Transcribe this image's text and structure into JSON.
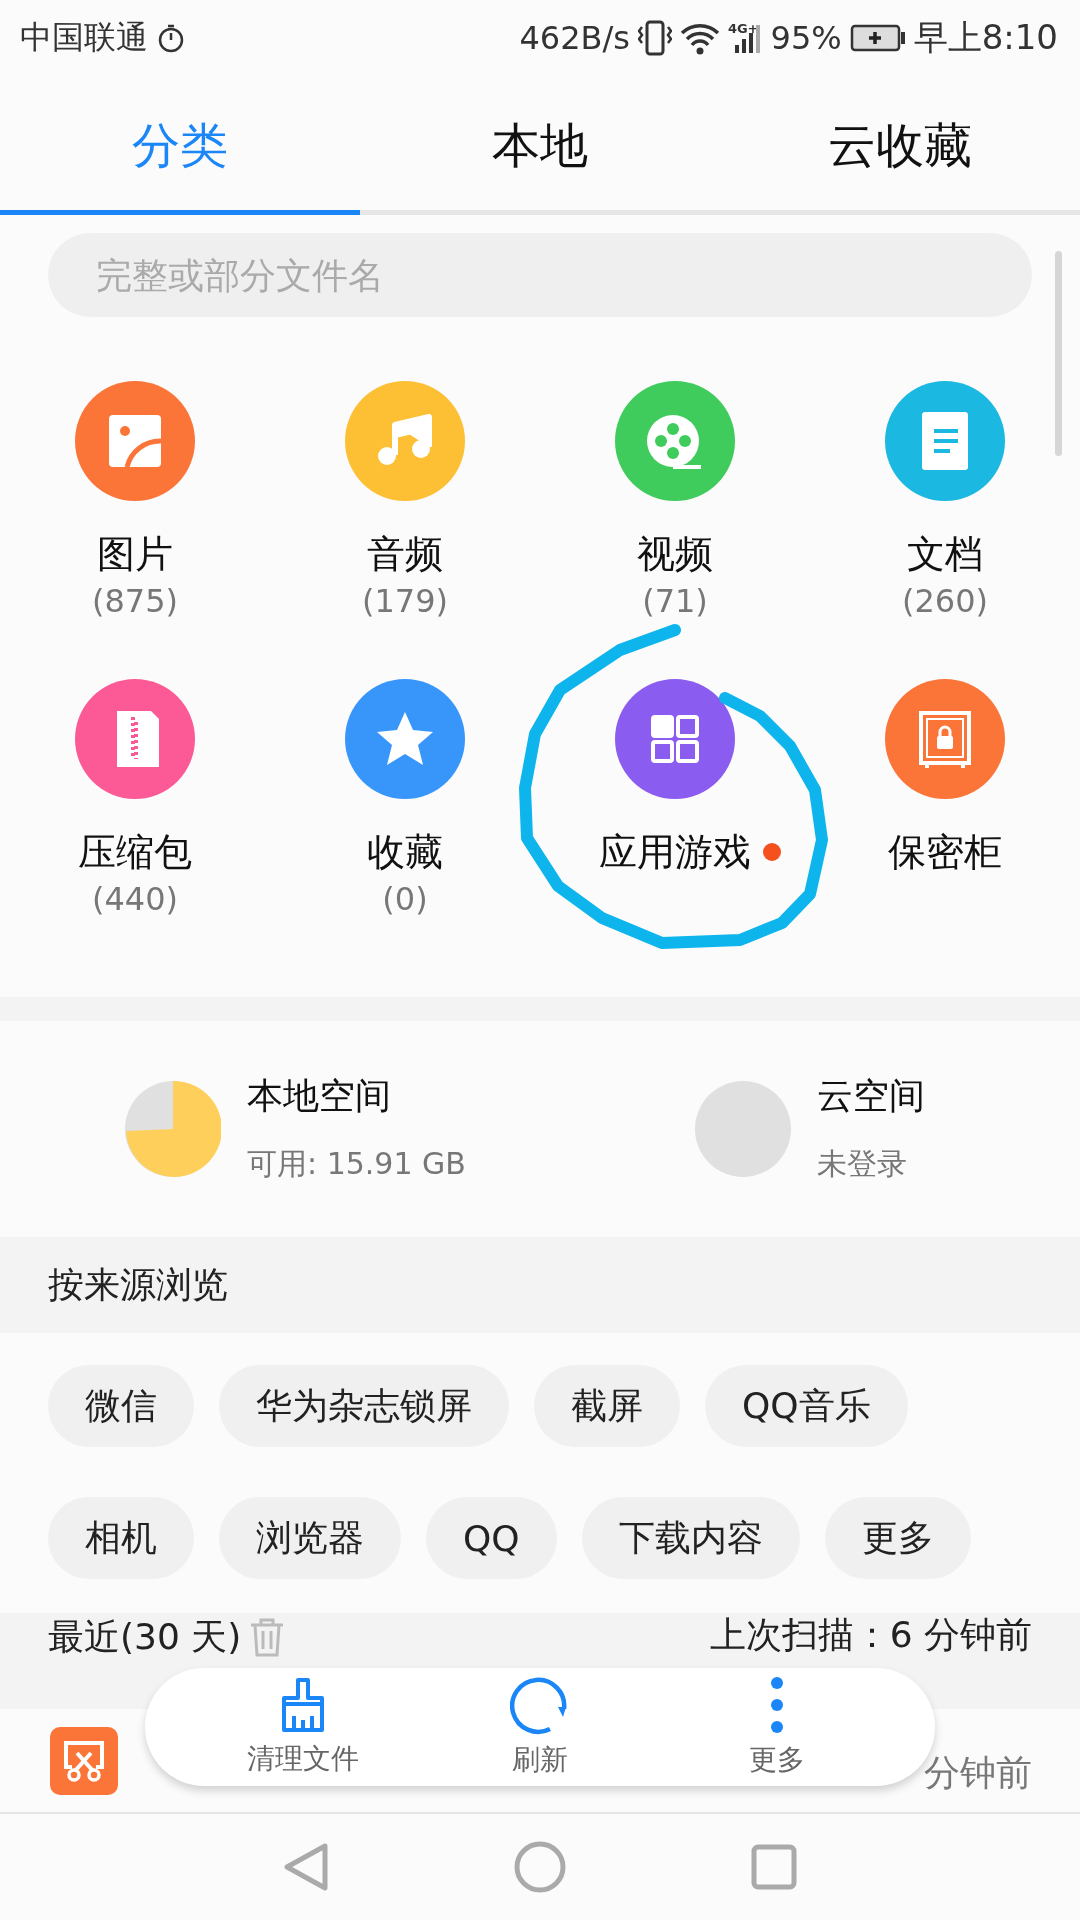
{
  "status_bar": {
    "carrier": "中国联通",
    "net_speed": "462B/s",
    "network": "4G+",
    "battery": "95%",
    "time": "早上8:10"
  },
  "tabs": [
    {
      "label": "分类",
      "selected": true
    },
    {
      "label": "本地",
      "selected": false
    },
    {
      "label": "云收藏",
      "selected": false
    }
  ],
  "search": {
    "placeholder": "完整或部分文件名"
  },
  "categories": [
    {
      "name": "图片",
      "count": "(875)",
      "color": "#fb7538",
      "dot": false
    },
    {
      "name": "音频",
      "count": "(179)",
      "color": "#fdbf33",
      "dot": false
    },
    {
      "name": "视频",
      "count": "(71)",
      "color": "#3fcc5c",
      "dot": false
    },
    {
      "name": "文档",
      "count": "(260)",
      "color": "#1bb8e2",
      "dot": false
    },
    {
      "name": "压缩包",
      "count": "(440)",
      "color": "#fb5a97",
      "dot": false
    },
    {
      "name": "收藏",
      "count": "(0)",
      "color": "#3896fb",
      "dot": false
    },
    {
      "name": "应用游戏",
      "color": "#8b5cf0",
      "dot": true
    },
    {
      "name": "保密柜",
      "color": "#fb7538",
      "dot": false
    }
  ],
  "storage": [
    {
      "title": "本地空间",
      "subtitle": "可用: 15.91 GB",
      "kind": "pie"
    },
    {
      "title": "云空间",
      "subtitle": "未登录"
    }
  ],
  "sources": {
    "title": "按来源浏览",
    "rows": [
      [
        "微信",
        "华为杂志锁屏",
        "截屏",
        "QQ音乐"
      ],
      [
        "相机",
        "浏览器",
        "QQ",
        "下载内容",
        "更多"
      ]
    ]
  },
  "recent": {
    "title": "最近(30 天)",
    "scan": "上次扫描：6 分钟前",
    "items": [
      {
        "time": "分钟前"
      }
    ]
  },
  "toolbar": [
    {
      "label": "清理文件"
    },
    {
      "label": "刷新"
    },
    {
      "label": "更多"
    }
  ]
}
